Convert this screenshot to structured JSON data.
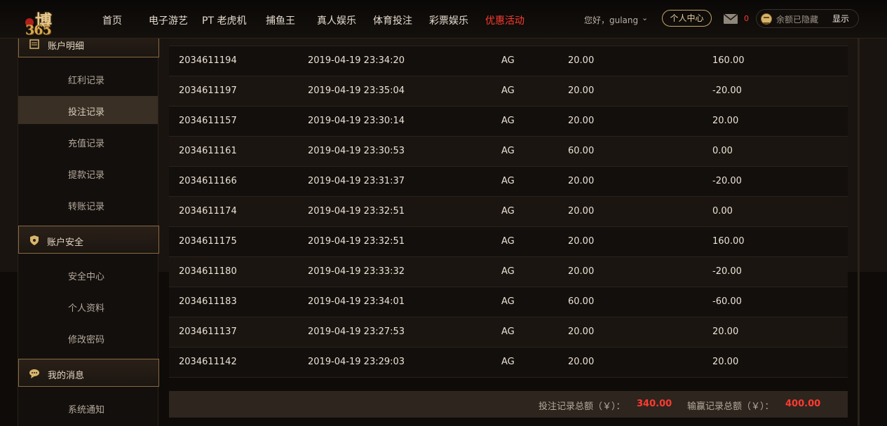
{
  "header": {
    "logo_text": "博",
    "logo_num": "365",
    "nav": [
      {
        "label": "首页"
      },
      {
        "label": "电子游艺"
      },
      {
        "label": "PT 老虎机"
      },
      {
        "label": "捕鱼王"
      },
      {
        "label": "真人娱乐"
      },
      {
        "label": "体育投注"
      },
      {
        "label": "彩票娱乐"
      },
      {
        "label": "优惠活动"
      }
    ],
    "greeting": "您好，gulang",
    "user_center": "个人中心",
    "mail_count": "0",
    "balance_hidden": "余额已隐藏",
    "show_label": "显示",
    "colors": {
      "promo": "#ff3b30",
      "gold": "#c8a46a"
    }
  },
  "sidebar": {
    "sections": [
      {
        "title": "账户明细",
        "icon": "ledger-icon",
        "items": [
          "红利记录",
          "投注记录",
          "充值记录",
          "提款记录",
          "转账记录"
        ]
      },
      {
        "title": "账户安全",
        "icon": "shield-icon",
        "items": [
          "安全中心",
          "个人资料",
          "修改密码"
        ]
      },
      {
        "title": "我的消息",
        "icon": "message-icon",
        "items": [
          "系统通知"
        ]
      }
    ],
    "active_item": "投注记录"
  },
  "table": {
    "rows": [
      [
        "2034611194",
        "2019-04-19 23:34:20",
        "AG",
        "20.00",
        "160.00"
      ],
      [
        "2034611197",
        "2019-04-19 23:35:04",
        "AG",
        "20.00",
        "-20.00"
      ],
      [
        "2034611157",
        "2019-04-19 23:30:14",
        "AG",
        "20.00",
        "20.00"
      ],
      [
        "2034611161",
        "2019-04-19 23:30:53",
        "AG",
        "60.00",
        "0.00"
      ],
      [
        "2034611166",
        "2019-04-19 23:31:37",
        "AG",
        "20.00",
        "-20.00"
      ],
      [
        "2034611174",
        "2019-04-19 23:32:51",
        "AG",
        "20.00",
        "0.00"
      ],
      [
        "2034611175",
        "2019-04-19 23:32:51",
        "AG",
        "20.00",
        "160.00"
      ],
      [
        "2034611180",
        "2019-04-19 23:33:32",
        "AG",
        "20.00",
        "-20.00"
      ],
      [
        "2034611183",
        "2019-04-19 23:34:01",
        "AG",
        "60.00",
        "-60.00"
      ],
      [
        "2034611137",
        "2019-04-19 23:27:53",
        "AG",
        "20.00",
        "20.00"
      ],
      [
        "2034611142",
        "2019-04-19 23:29:03",
        "AG",
        "20.00",
        "20.00"
      ]
    ]
  },
  "summary": {
    "bet_total_label": "投注记录总额（￥）：",
    "bet_total_value": "340.00",
    "win_total_label": "输赢记录总额（￥）：",
    "win_total_value": "400.00"
  }
}
